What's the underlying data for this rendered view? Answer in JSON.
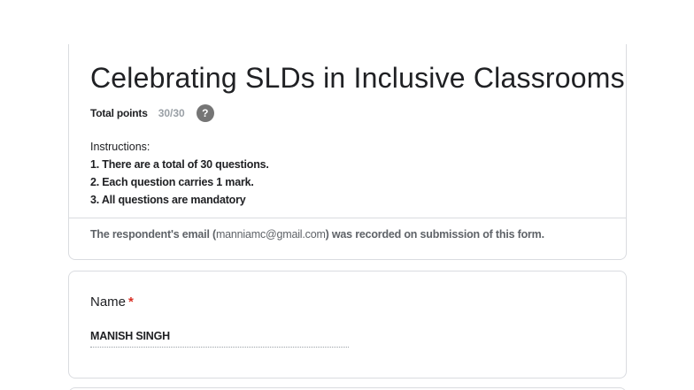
{
  "form": {
    "title": "Celebrating SLDs in Inclusive Classrooms",
    "points_label": "Total points",
    "points_value": "30/30",
    "help_icon_glyph": "?",
    "instructions": {
      "heading": "Instructions:",
      "items": [
        "1. There are a total of 30 questions.",
        "2. Each question carries 1 mark.",
        "3. All questions are mandatory"
      ]
    },
    "email_note": {
      "before": "The respondent's email (",
      "email": "manniamc@gmail.com",
      "after": ") was recorded on submission of this form."
    }
  },
  "questions": [
    {
      "label": "Name",
      "required_mark": "*",
      "answer": "MANISH SINGH"
    }
  ],
  "colors": {
    "border": "#dadce0",
    "required": "#d93025",
    "muted": "#9aa0a6",
    "help_icon": "#757575"
  }
}
